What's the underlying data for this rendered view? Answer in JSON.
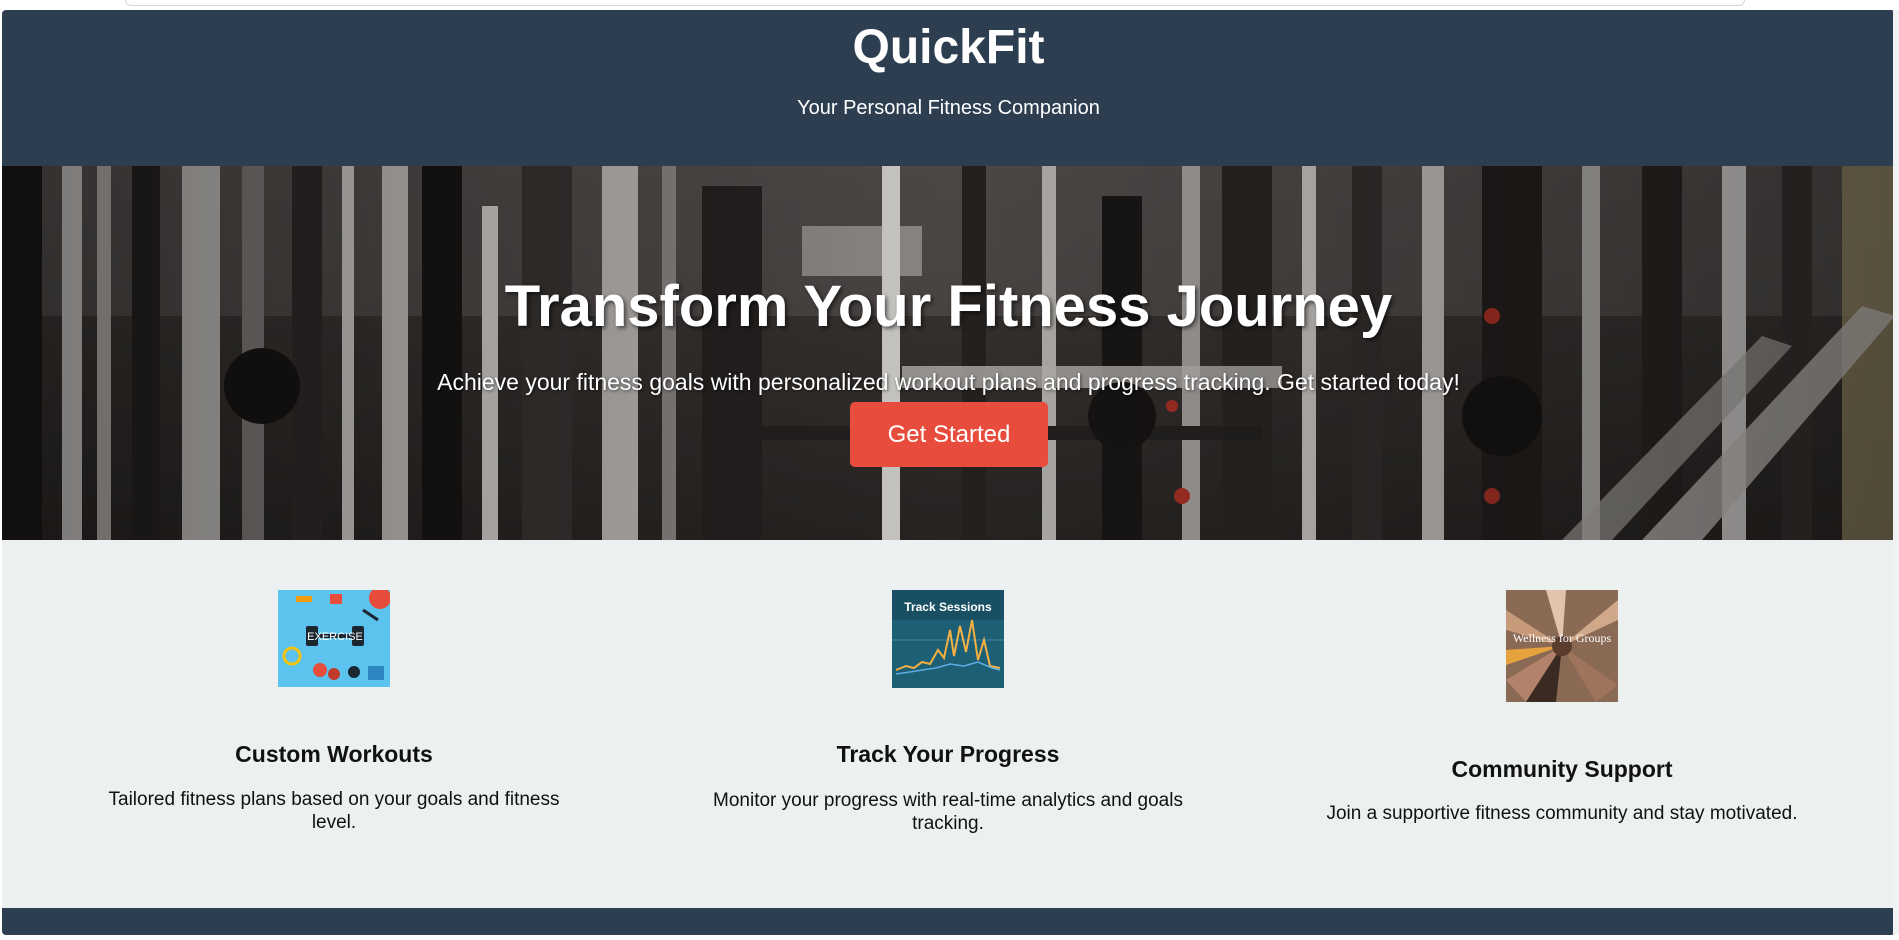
{
  "header": {
    "title": "QuickFit",
    "tagline": "Your Personal Fitness Companion"
  },
  "hero": {
    "title": "Transform Your Fitness Journey",
    "text": "Achieve your fitness goals with personalized workout plans and progress tracking. Get started today!",
    "cta_label": "Get Started"
  },
  "features": [
    {
      "title": "Custom Workouts",
      "text": "Tailored fitness plans based on your goals and fitness level.",
      "image_caption": "EXERCISE"
    },
    {
      "title": "Track Your Progress",
      "text": "Monitor your progress with real-time analytics and goals tracking.",
      "image_caption": "Track Sessions"
    },
    {
      "title": "Community Support",
      "text": "Join a supportive fitness community and stay motivated.",
      "image_caption": "Wellness for Groups"
    }
  ],
  "colors": {
    "header_bg": "#2c3e50",
    "page_bg": "#ecf0f1",
    "cta_bg": "#e74c3c"
  }
}
